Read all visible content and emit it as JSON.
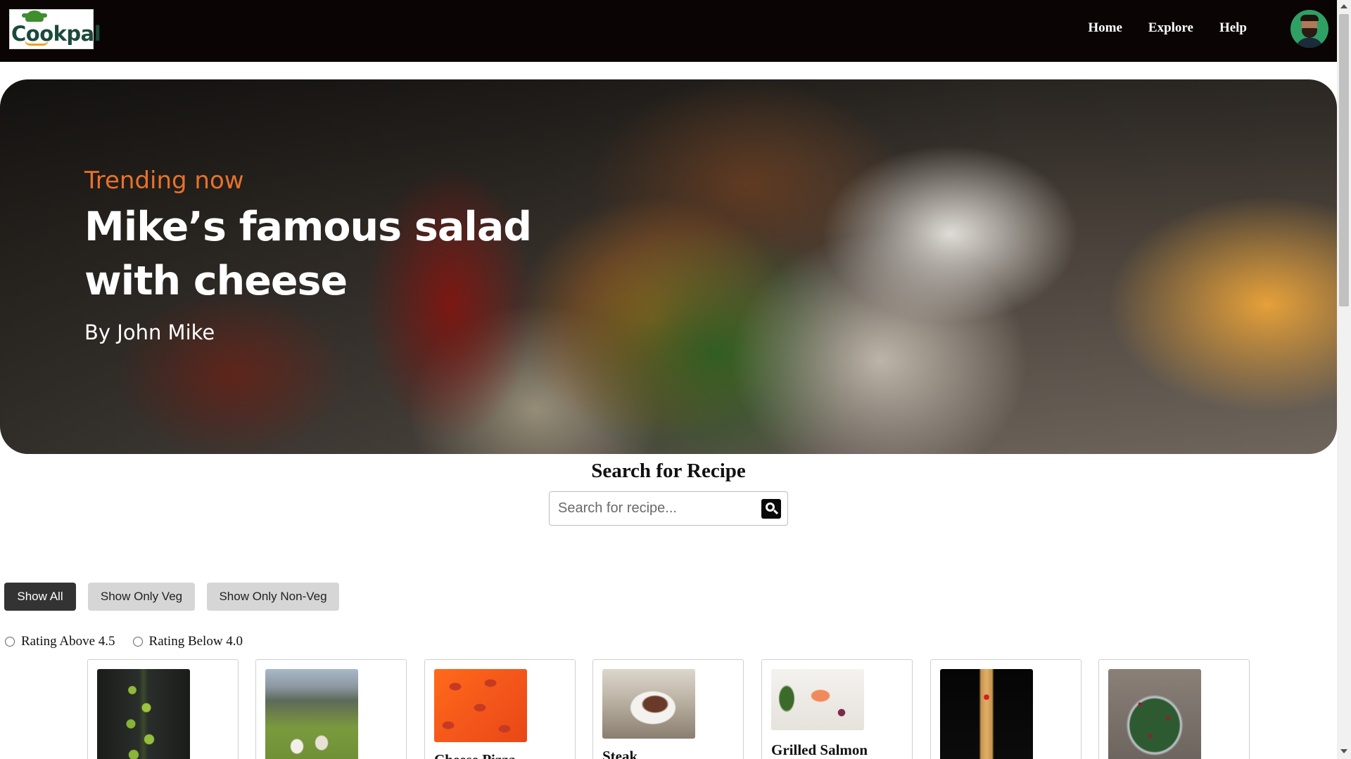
{
  "brand": {
    "logo_text": "Cookpal"
  },
  "nav": {
    "links": [
      "Home",
      "Explore",
      "Help"
    ]
  },
  "hero": {
    "eyebrow": "Trending now",
    "title": "Mike’s famous salad with cheese",
    "author": "By John Mike"
  },
  "search": {
    "title": "Search for Recipe",
    "placeholder": "Search for recipe...",
    "value": "",
    "button_icon": "search-icon"
  },
  "filters": {
    "buttons": [
      "Show All",
      "Show Only Veg",
      "Show Only Non-Veg"
    ],
    "active": "Show All",
    "ratings": [
      "Rating Above 4.5",
      "Rating Below 4.0"
    ]
  },
  "recipes": [
    {
      "name": "",
      "image": "brussels-sprouts-photo"
    },
    {
      "name": "",
      "image": "chickens-field-photo"
    },
    {
      "name": "Cheese Pizza",
      "image": "pizza-slices-photo"
    },
    {
      "name": "Steak",
      "image": "steak-plate-photo"
    },
    {
      "name": "Grilled Salmon",
      "image": "salmon-vegetables-photo"
    },
    {
      "name": "",
      "image": "spaghetti-fork-photo"
    },
    {
      "name": "",
      "image": "salad-bowl-photo"
    }
  ],
  "colors": {
    "navbar_bg": "#0a0405",
    "accent_orange": "#e8722a",
    "active_button": "#333333",
    "inactive_button": "#d6d6d6",
    "avatar_bg": "#2fa063"
  }
}
